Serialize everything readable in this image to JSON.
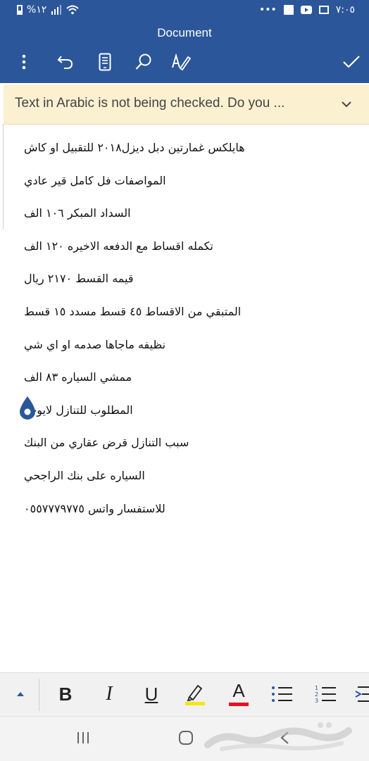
{
  "status_bar": {
    "battery": "%١٢",
    "time": "٧:٠٥",
    "dots": "•••"
  },
  "app_bar": {
    "title": "Document"
  },
  "notice": {
    "text": "Text in Arabic is not being checked. Do you ..."
  },
  "document": {
    "lines": [
      "هايلكس غمارتين دبل ديزل٢٠١٨  للتقبيل او كاش",
      "المواصفات فل كامل قير عادي",
      "السداد المبكر ١٠٦ الف",
      "تكمله اقساط مع الدفعه الاخيره ١٢٠ الف",
      "قيمه القسط ٢١٧٠ ريال",
      "المتبقي من الاقساط ٤٥ قسط مسدد ١٥ قسط",
      "نظيفه ماجاها صدمه او اي شي",
      "ممشي السياره ٨٣ الف",
      "المطلوب للتنازل لايوجد",
      "سبب التنازل قرض عقاري من البنك",
      "السياره على بنك الراجحي",
      "للاستفسار واتس ٠٥٥٧٧٧٩٧٧٥"
    ]
  },
  "format_bar": {
    "bold": "B",
    "italic": "I",
    "underline": "U",
    "font_color": "A",
    "highlight_color": "#f5e51b",
    "font_color_value": "#e81123"
  },
  "theme": {
    "brand": "#2b579a",
    "notice_bg": "#fbf0d0"
  }
}
